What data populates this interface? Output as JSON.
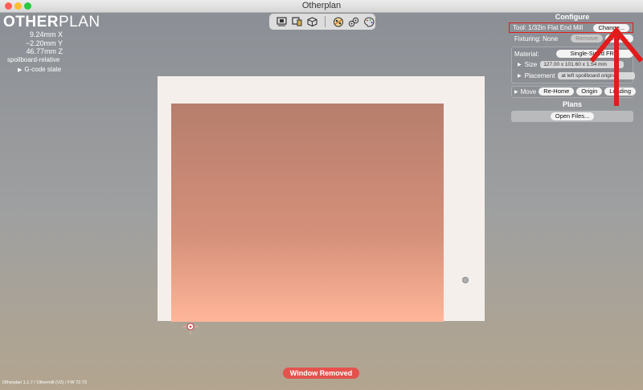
{
  "window": {
    "title": "Otherplan"
  },
  "logo": {
    "bold": "OTHER",
    "light": "PLAN"
  },
  "position": {
    "x": "9.24mm X",
    "y": "−2.20mm Y",
    "z": "46.77mm Z",
    "mode": "spoilboard-relative",
    "gcode_label": "G-code state"
  },
  "viewbar": {
    "icons": [
      "front-view-icon",
      "side-view-icon",
      "iso-view-icon",
      "bits-icon",
      "gear-bits-icon",
      "palette-icon"
    ]
  },
  "configure": {
    "title": "Configure",
    "tool_label": "Tool: 1/32in Flat End Mill",
    "tool_change": "Change...",
    "fixturing_label": "Fixturing: None",
    "fixturing_remove": "Remove",
    "fixturing_load": "Load...",
    "material_label": "Material:",
    "material_value": "Single-Sided FR-1",
    "size_label": "Size",
    "size_value": "127.00 x 101.60 x 1.54 mm",
    "placement_label": "Placement",
    "placement_value": "at left spoilboard origin",
    "move_label": "Move",
    "move_rehome": "Re-Home",
    "move_origin": "Origin",
    "move_loading": "Loading"
  },
  "plans": {
    "title": "Plans",
    "open_files": "Open Files..."
  },
  "notice": {
    "text": "Window Removed"
  },
  "footer": {
    "version": "Otherplan 1.1.7 / Othermill (V2) / FW 72.73"
  },
  "colors": {
    "highlight": "#e31b1b",
    "notice": "#e4524d",
    "material_top": "#b67e6d",
    "material_bottom": "#ffb699"
  }
}
